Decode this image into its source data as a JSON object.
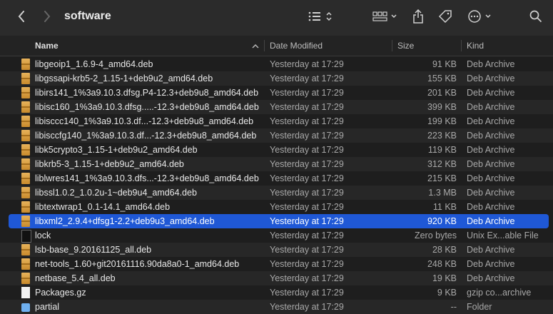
{
  "window": {
    "title": "software"
  },
  "columns": {
    "name": "Name",
    "date": "Date Modified",
    "size": "Size",
    "kind": "Kind"
  },
  "icons": {
    "back": "chevron-left-icon",
    "forward": "chevron-right-icon",
    "view": "list-view-icon",
    "group": "group-icon",
    "share": "share-icon",
    "tag": "tag-icon",
    "more": "more-icon",
    "search": "search-icon",
    "sort": "sort-chevron-up-icon"
  },
  "colors": {
    "selection": "#1f58d6",
    "background": "#1e1e1e",
    "folder": "#6fb0f0"
  },
  "files": [
    {
      "name": "libgeoip1_1.6.9-4_amd64.deb",
      "date": "Yesterday at 17:29",
      "size": "91 KB",
      "kind": "Deb Archive",
      "type": "deb"
    },
    {
      "name": "libgssapi-krb5-2_1.15-1+deb9u2_amd64.deb",
      "date": "Yesterday at 17:29",
      "size": "155 KB",
      "kind": "Deb Archive",
      "type": "deb"
    },
    {
      "name": "libirs141_1%3a9.10.3.dfsg.P4-12.3+deb9u8_amd64.deb",
      "date": "Yesterday at 17:29",
      "size": "201 KB",
      "kind": "Deb Archive",
      "type": "deb"
    },
    {
      "name": "libisc160_1%3a9.10.3.dfsg.....-12.3+deb9u8_amd64.deb",
      "date": "Yesterday at 17:29",
      "size": "399 KB",
      "kind": "Deb Archive",
      "type": "deb"
    },
    {
      "name": "libisccc140_1%3a9.10.3.df...-12.3+deb9u8_amd64.deb",
      "date": "Yesterday at 17:29",
      "size": "199 KB",
      "kind": "Deb Archive",
      "type": "deb"
    },
    {
      "name": "libisccfg140_1%3a9.10.3.df...-12.3+deb9u8_amd64.deb",
      "date": "Yesterday at 17:29",
      "size": "223 KB",
      "kind": "Deb Archive",
      "type": "deb"
    },
    {
      "name": "libk5crypto3_1.15-1+deb9u2_amd64.deb",
      "date": "Yesterday at 17:29",
      "size": "119 KB",
      "kind": "Deb Archive",
      "type": "deb"
    },
    {
      "name": "libkrb5-3_1.15-1+deb9u2_amd64.deb",
      "date": "Yesterday at 17:29",
      "size": "312 KB",
      "kind": "Deb Archive",
      "type": "deb"
    },
    {
      "name": "liblwres141_1%3a9.10.3.dfs...-12.3+deb9u8_amd64.deb",
      "date": "Yesterday at 17:29",
      "size": "215 KB",
      "kind": "Deb Archive",
      "type": "deb"
    },
    {
      "name": "libssl1.0.2_1.0.2u-1~deb9u4_amd64.deb",
      "date": "Yesterday at 17:29",
      "size": "1.3 MB",
      "kind": "Deb Archive",
      "type": "deb"
    },
    {
      "name": "libtextwrap1_0.1-14.1_amd64.deb",
      "date": "Yesterday at 17:29",
      "size": "11 KB",
      "kind": "Deb Archive",
      "type": "deb"
    },
    {
      "name": "libxml2_2.9.4+dfsg1-2.2+deb9u3_amd64.deb",
      "date": "Yesterday at 17:29",
      "size": "920 KB",
      "kind": "Deb Archive",
      "type": "deb",
      "selected": true
    },
    {
      "name": "lock",
      "date": "Yesterday at 17:29",
      "size": "Zero bytes",
      "kind": "Unix Ex...able File",
      "type": "exec"
    },
    {
      "name": "lsb-base_9.20161125_all.deb",
      "date": "Yesterday at 17:29",
      "size": "28 KB",
      "kind": "Deb Archive",
      "type": "deb"
    },
    {
      "name": "net-tools_1.60+git20161116.90da8a0-1_amd64.deb",
      "date": "Yesterday at 17:29",
      "size": "248 KB",
      "kind": "Deb Archive",
      "type": "deb"
    },
    {
      "name": "netbase_5.4_all.deb",
      "date": "Yesterday at 17:29",
      "size": "19 KB",
      "kind": "Deb Archive",
      "type": "deb"
    },
    {
      "name": "Packages.gz",
      "date": "Yesterday at 17:29",
      "size": "9 KB",
      "kind": "gzip co...archive",
      "type": "file"
    },
    {
      "name": "partial",
      "date": "Yesterday at 17:29",
      "size": "--",
      "kind": "Folder",
      "type": "folder"
    }
  ]
}
